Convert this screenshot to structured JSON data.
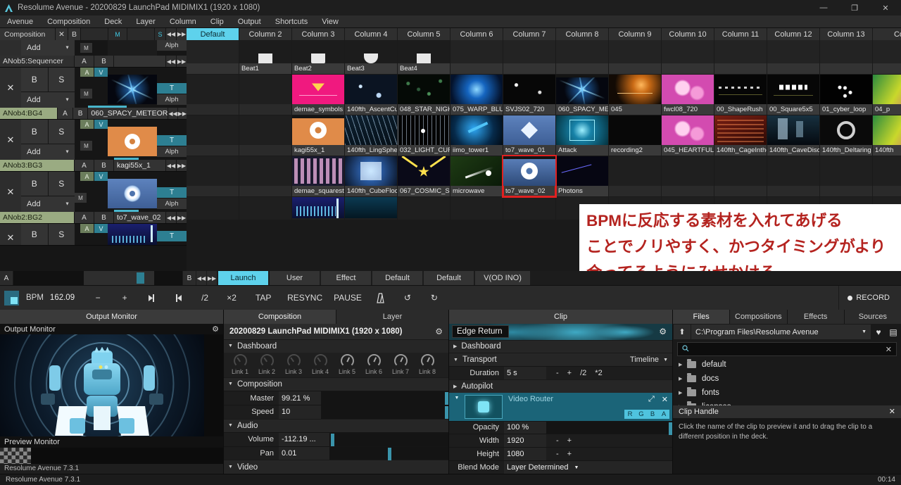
{
  "window": {
    "title": "Resolume Avenue - 20200829 LaunchPad MIDIMIX1 (1920 x 1080)",
    "minimize": "—",
    "maximize": "❐",
    "close": "✕"
  },
  "menu": [
    "Avenue",
    "Composition",
    "Deck",
    "Layer",
    "Column",
    "Clip",
    "Output",
    "Shortcuts",
    "View"
  ],
  "composition_row": {
    "name": "Composition",
    "close": "✕",
    "b": "B",
    "m": "M",
    "s": "S",
    "prev": "◀◀",
    "next": "▶▶"
  },
  "columns": [
    {
      "label": "Default",
      "active": true
    },
    {
      "label": "Column 2",
      "active": false
    },
    {
      "label": "Column 3",
      "active": false
    },
    {
      "label": "Column 4",
      "active": false
    },
    {
      "label": "Column 5",
      "active": false
    },
    {
      "label": "Column 6",
      "active": false
    },
    {
      "label": "Column 7",
      "active": false
    },
    {
      "label": "Column 8",
      "active": false
    },
    {
      "label": "Column 9",
      "active": false
    },
    {
      "label": "Column 10",
      "active": false
    },
    {
      "label": "Column 11",
      "active": false
    },
    {
      "label": "Column 12",
      "active": false
    },
    {
      "label": "Column 13",
      "active": false
    },
    {
      "label": "Co",
      "active": false
    }
  ],
  "layers": [
    {
      "name": "ANob5:Sequencer",
      "name_dim": true,
      "blend": "Add",
      "b": "B",
      "s": "S",
      "m": "M",
      "a": "A",
      "v": "V",
      "t": "T",
      "alpha": "Alph",
      "x": "✕",
      "ab_a": "A",
      "ab_b": "B",
      "clip": "",
      "prev": "◀◀",
      "next": "▶▶"
    },
    {
      "name": "ANob4:BG4",
      "name_dim": false,
      "blend": "Add",
      "b": "B",
      "s": "S",
      "m": "M",
      "a": "A",
      "v": "V",
      "t": "T",
      "alpha": "Alph",
      "x": "✕",
      "ab_a": "A",
      "ab_b": "B",
      "clip": "060_SPACY_METEOR",
      "prev": "◀◀",
      "next": "▶▶"
    },
    {
      "name": "ANob3:BG3",
      "name_dim": false,
      "blend": "Add",
      "b": "B",
      "s": "S",
      "m": "M",
      "a": "A",
      "v": "V",
      "t": "T",
      "alpha": "Alph",
      "x": "✕",
      "ab_a": "A",
      "ab_b": "B",
      "clip": "kagi55x_1",
      "prev": "◀◀",
      "next": "▶▶"
    },
    {
      "name": "ANob2:BG2",
      "name_dim": false,
      "blend": "Add",
      "b": "B",
      "s": "S",
      "m": "M",
      "a": "A",
      "v": "V",
      "t": "T",
      "alpha": "Alph",
      "x": "✕",
      "ab_a": "A",
      "ab_b": "B",
      "clip": "to7_wave_02",
      "prev": "◀◀",
      "next": "▶▶"
    }
  ],
  "grid": {
    "beat_row": [
      "",
      "Beat1",
      "Beat2",
      "Beat3",
      "Beat4",
      "",
      "",
      "",
      "",
      "",
      "",
      "",
      "",
      ""
    ],
    "rows": [
      {
        "clips": [
          "",
          "",
          "demae_symbols",
          "140fth_AscentCube",
          "048_STAR_NIGHT_2",
          "075_WARP_BLUE",
          "SVJS02_720",
          "060_SPACY_METEOR",
          "045",
          "fwcl08_720",
          "00_ShapeRush",
          "00_Square5x5",
          "01_cyber_loop",
          "04_p"
        ],
        "selected": 7
      },
      {
        "clips": [
          "",
          "",
          "kagi55x_1",
          "140fth_LingSpher...",
          "032_LIGHT_CURT...",
          "iimo_tower1",
          "to7_wave_01",
          "Attack",
          "recording2",
          "045_HEARTFUL_N...",
          "140fth_CageInthe...",
          "140fth_CaveDiscent",
          "140fth_Deltaring",
          "140fth"
        ],
        "selected": 2
      },
      {
        "clips": [
          "",
          "",
          "demae_squarestr...",
          "140fth_CubeFlock",
          "067_COSMIC_STAR",
          "microwave",
          "to7_wave_02",
          "Photons",
          "",
          "",
          "",
          "",
          "",
          ""
        ],
        "selected": 6,
        "selected_red": true
      },
      {
        "clips": [
          "",
          "",
          "",
          "",
          "",
          "",
          "",
          "",
          "",
          "",
          "",
          "",
          "",
          ""
        ],
        "selected": -1
      }
    ]
  },
  "overlay": {
    "lines": [
      "BPMに反応する素材を入れてあげる",
      "ことでノリやすく、かつタイミングがより",
      "合ってるようにみせかける"
    ],
    "color": "#b4231f"
  },
  "crossfader": {
    "a": "A",
    "b": "B",
    "prev": "◀◀",
    "next": "▶▶"
  },
  "deck_tabs": [
    {
      "label": "Launch",
      "active": true
    },
    {
      "label": "User",
      "active": false
    },
    {
      "label": "Effect",
      "active": false
    },
    {
      "label": "Default",
      "active": false
    },
    {
      "label": "Default",
      "active": false
    },
    {
      "label": "V(OD INO)",
      "active": false
    }
  ],
  "transport": {
    "bpm_label": "BPM",
    "bpm_value": "162.09",
    "minus": "−",
    "plus": "+",
    "nudge_left": "⇥",
    "nudge_right": "⇤",
    "half": "/2",
    "double": "×2",
    "tap": "TAP",
    "resync": "RESYNC",
    "pause": "PAUSE",
    "metronome": "metronome-icon",
    "undo": "↺",
    "redo": "↻",
    "record": "RECORD"
  },
  "monitor": {
    "tab": "Output Monitor",
    "output_label": "Output Monitor",
    "preview_label": "Preview Monitor",
    "gear": "⚙",
    "version": "Resolume Avenue 7.3.1"
  },
  "composition_panel": {
    "tabs": [
      {
        "label": "Composition",
        "active": true
      },
      {
        "label": "Layer",
        "active": false
      }
    ],
    "title": "20200829 LaunchPad MIDIMIX1 (1920 x 1080)",
    "gear": "⚙",
    "sections": {
      "dashboard": "Dashboard",
      "composition": "Composition",
      "audio": "Audio",
      "video": "Video"
    },
    "links": [
      "Link 1",
      "Link 2",
      "Link 3",
      "Link 4",
      "Link 5",
      "Link 6",
      "Link 7",
      "Link 8"
    ],
    "params": [
      {
        "label": "Master",
        "value": "99.21 %",
        "handle": 97
      },
      {
        "label": "Speed",
        "value": "10",
        "handle": 97
      },
      {
        "label": "Volume",
        "value": "-112.19 ...",
        "handle": 2
      },
      {
        "label": "Pan",
        "value": "0.01",
        "handle": 49
      }
    ]
  },
  "clip_panel": {
    "tab": "Clip",
    "name": "Edge Return",
    "gear": "⚙",
    "sections": {
      "dashboard": "Dashboard",
      "transport": "Transport",
      "autopilot": "Autopilot"
    },
    "transport_mode": "Timeline",
    "duration_label": "Duration",
    "duration_value": "5 s",
    "duration_btns": [
      "-",
      "+",
      "/2",
      "*2"
    ],
    "router": {
      "label": "Video Router",
      "expand": "⤢",
      "close": "✕",
      "channels": [
        "R",
        "G",
        "B",
        "A"
      ]
    },
    "params": [
      {
        "label": "Opacity",
        "value": "100 %",
        "handle": 97
      },
      {
        "label": "Width",
        "value": "1920",
        "btns": [
          "-",
          "+"
        ]
      },
      {
        "label": "Height",
        "value": "1080",
        "btns": [
          "-",
          "+"
        ]
      },
      {
        "label": "Blend Mode",
        "value": "Layer Determined",
        "caret": "▼"
      }
    ]
  },
  "files_panel": {
    "tabs": [
      {
        "label": "Files",
        "active": true
      },
      {
        "label": "Compositions",
        "active": false
      },
      {
        "label": "Effects",
        "active": false
      },
      {
        "label": "Sources",
        "active": false
      }
    ],
    "up": "⬆",
    "path": "C:\\Program Files\\Resolume Avenue",
    "path_caret": "▼",
    "favorite": "♥",
    "viewmode": "▤",
    "search_placeholder": "",
    "search_value": "",
    "search_clear": "✕",
    "folders": [
      "default",
      "docs",
      "fonts",
      "licenses"
    ],
    "clip_handle": {
      "title": "Clip Handle",
      "close": "✕",
      "text": "Click the name of the clip to preview it and to drag the clip to a different position in the deck."
    }
  },
  "statusbar": {
    "left": "Resolume Avenue 7.3.1",
    "time": "00:14"
  }
}
